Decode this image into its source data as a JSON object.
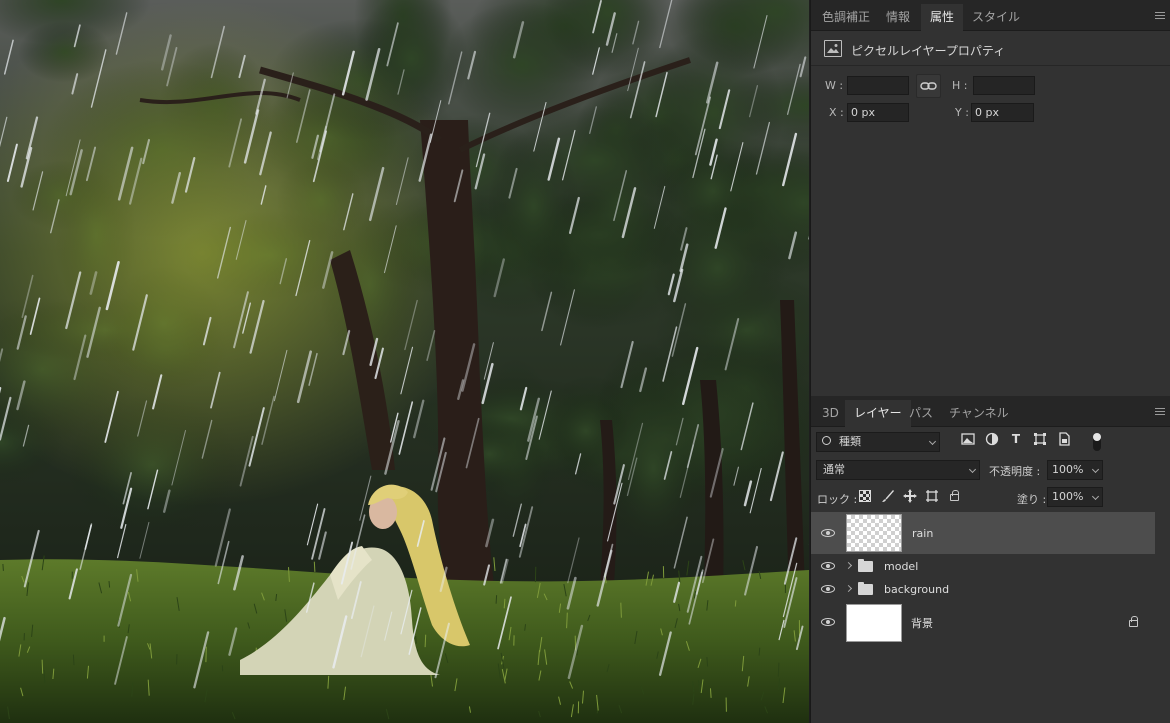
{
  "properties_panel": {
    "tabs": [
      "色調補正",
      "情報",
      "属性",
      "スタイル"
    ],
    "active_tab": "属性",
    "header_title": "ピクセルレイヤープロパティ",
    "w_label": "W :",
    "w_value": "",
    "h_label": "H :",
    "h_value": "",
    "x_label": "X :",
    "x_value": "0 px",
    "y_label": "Y :",
    "y_value": "0 px"
  },
  "layers_panel": {
    "tabs": [
      "3D",
      "レイヤー",
      "パス",
      "チャンネル"
    ],
    "active_tab": "レイヤー",
    "filter_kind": "種類",
    "blend_mode": "通常",
    "opacity_label": "不透明度 :",
    "opacity_value": "100%",
    "lock_label": "ロック :",
    "fill_label": "塗り :",
    "fill_value": "100%",
    "layers": [
      {
        "name": "rain",
        "type": "pixel",
        "visible": true,
        "selected": true
      },
      {
        "name": "model",
        "type": "group",
        "visible": true,
        "selected": false
      },
      {
        "name": "background",
        "type": "group",
        "visible": true,
        "selected": false
      },
      {
        "name": "背景",
        "type": "background",
        "visible": true,
        "selected": false,
        "locked": true
      }
    ]
  },
  "icons": {
    "link": "link-icon",
    "filter_search": "search-icon",
    "panel_menu": "menu-icon"
  },
  "colors": {
    "panel_bg": "#323232",
    "tab_bar_bg": "#262626",
    "selected_layer_bg": "#4d4d4d"
  }
}
